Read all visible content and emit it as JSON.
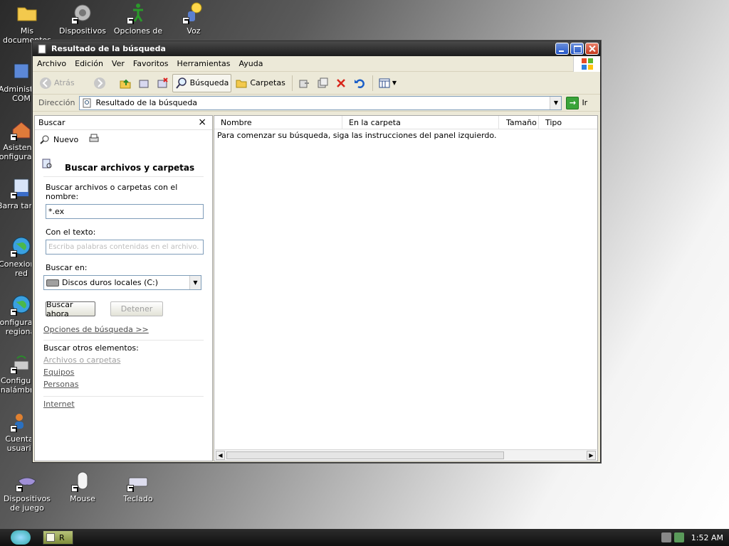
{
  "desktop": {
    "icons": [
      {
        "label": "Mis documentos",
        "icon": "folder-icon"
      },
      {
        "label": "Dispositivos de sonido",
        "icon": "speaker-icon"
      },
      {
        "label": "Opciones de accesibilidad",
        "icon": "accessibility-icon"
      },
      {
        "label": "Voz",
        "icon": "speech-icon"
      },
      {
        "label": "Administrar COM",
        "icon": "admin-icon"
      },
      {
        "label": "Asistente configuración",
        "icon": "wizard-icon"
      },
      {
        "label": "Barra tareas",
        "icon": "taskbar-icon"
      },
      {
        "label": "Conexiones red",
        "icon": "globe-icon"
      },
      {
        "label": "Configuración regional",
        "icon": "globe-icon"
      },
      {
        "label": "Configurar inalámbrica",
        "icon": "wireless-icon"
      },
      {
        "label": "Cuentas usuario",
        "icon": "users-icon"
      },
      {
        "label": "Dispositivos de juego",
        "icon": "gamepad-icon"
      },
      {
        "label": "Mouse",
        "icon": "mouse-icon"
      },
      {
        "label": "Teclado",
        "icon": "keyboard-icon"
      }
    ]
  },
  "window": {
    "title": "Resultado de la búsqueda",
    "menu": [
      "Archivo",
      "Edición",
      "Ver",
      "Favoritos",
      "Herramientas",
      "Ayuda"
    ],
    "toolbar": {
      "back": "Atrás",
      "search": "Búsqueda",
      "folders": "Carpetas"
    },
    "address": {
      "label": "Dirección",
      "value": "Resultado de la búsqueda",
      "go": "Ir"
    }
  },
  "search_pane": {
    "header": "Buscar",
    "close": "×",
    "new": "Nuevo",
    "title": "Buscar archivos y carpetas",
    "name_label": "Buscar archivos o carpetas con el nombre:",
    "name_value": "*.ex",
    "text_label": "Con el texto:",
    "text_placeholder": "Escriba palabras contenidas en el archivo.",
    "look_in_label": "Buscar en:",
    "look_in_value": "Discos duros locales (C:)",
    "search_button": "Buscar ahora",
    "stop_button": "Detener",
    "options_link": "Opciones de búsqueda >>",
    "other_label": "Buscar otros elementos:",
    "other_links": [
      "Archivos o carpetas",
      "Equipos",
      "Personas",
      "Internet"
    ]
  },
  "results": {
    "columns": [
      "Nombre",
      "En la carpeta",
      "Tamaño",
      "Tipo"
    ],
    "message": "Para comenzar su búsqueda, siga las instrucciones del panel izquierdo."
  },
  "taskbar": {
    "task_label": "R",
    "clock": "1:52 AM"
  }
}
